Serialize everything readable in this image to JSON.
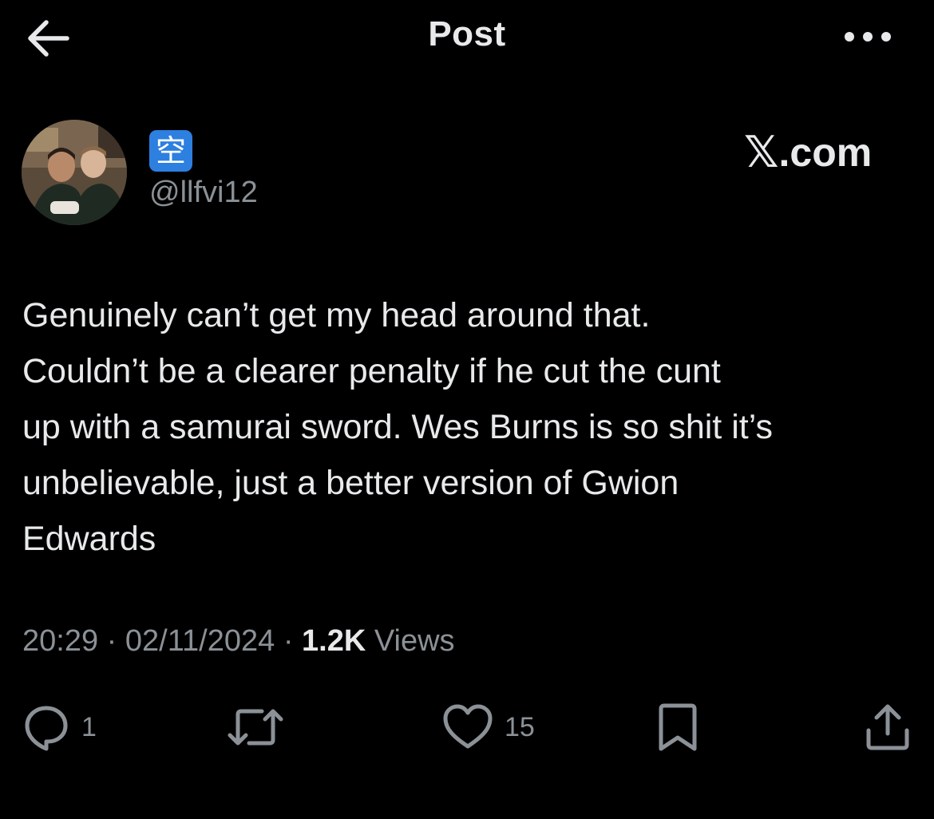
{
  "header": {
    "title": "Post",
    "back_icon": "arrow-left-icon",
    "more_icon": "more-horizontal-icon"
  },
  "author": {
    "name_badge": "空",
    "handle": "@llfvi12",
    "avatar": "avatar-photo"
  },
  "watermark": {
    "symbol": "𝕏",
    "text": ".com"
  },
  "post": {
    "text": "Genuinely can’t get my head around that.\nCouldn’t be a clearer penalty if he cut the cunt\nup with a samurai sword. Wes Burns is so shit it’s\nunbelievable, just a better version of Gwion\nEdwards",
    "time": "20:29",
    "separator": "·",
    "date": "02/11/2024",
    "views_count": "1.2K",
    "views_label": "Views"
  },
  "actions": {
    "reply_count": "1",
    "repost_count": "",
    "like_count": "15"
  },
  "colors": {
    "background": "#000000",
    "text_primary": "#e7e9ea",
    "text_secondary": "#8b9196",
    "badge_blue": "#2d7fe0"
  }
}
